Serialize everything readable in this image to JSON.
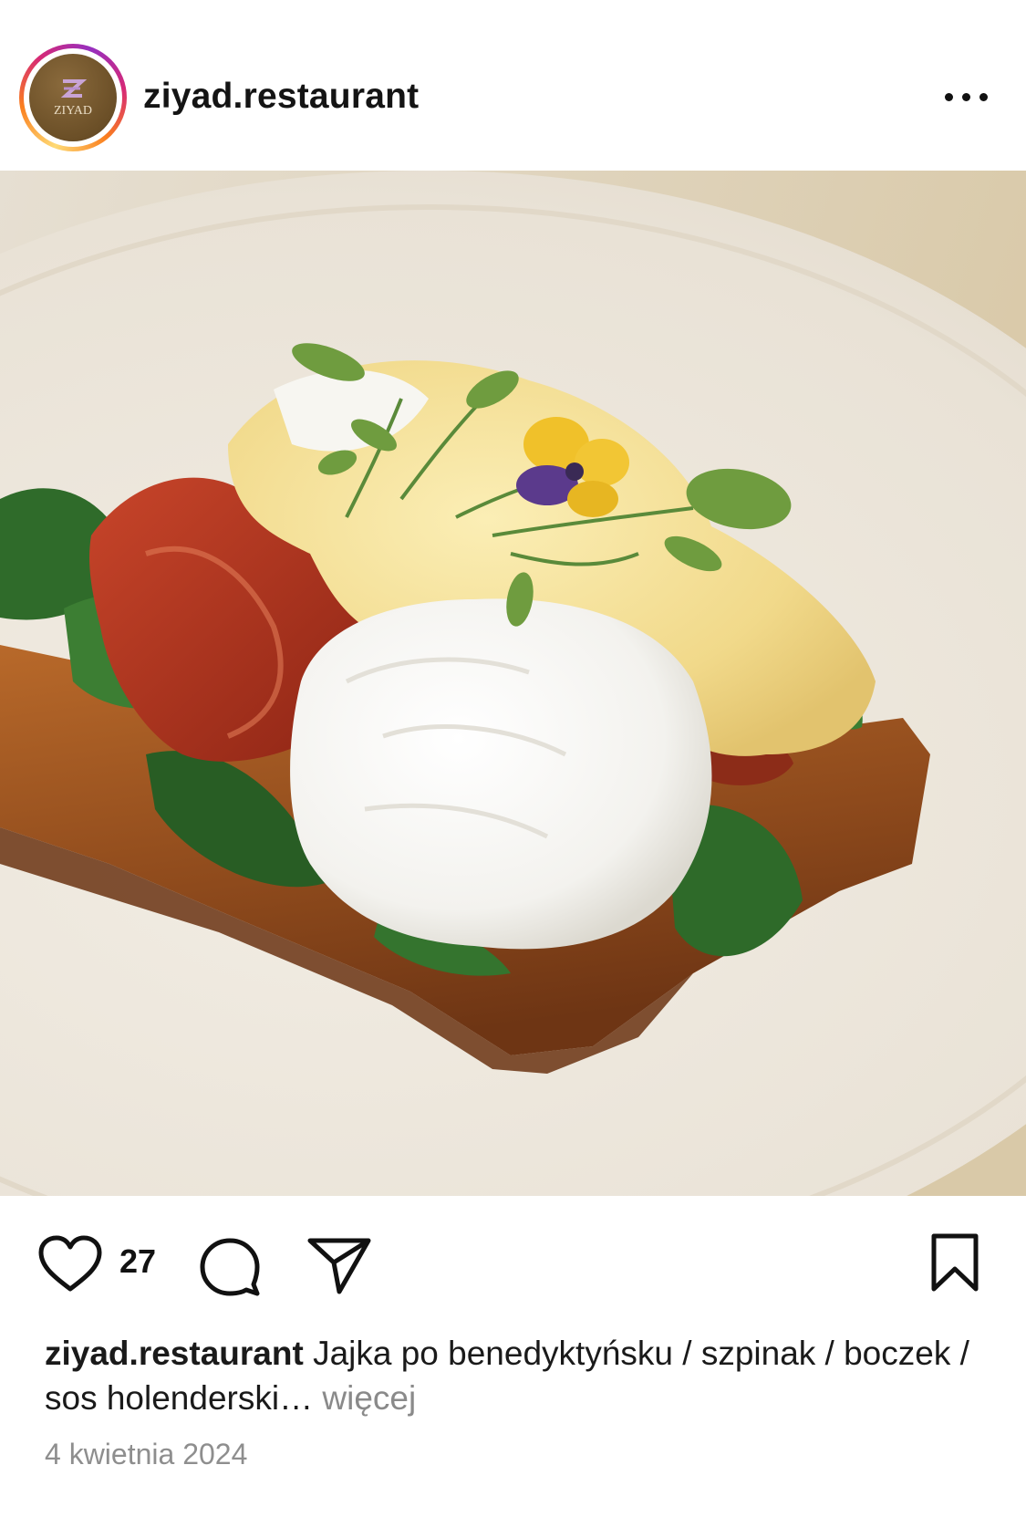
{
  "post": {
    "username": "ziyad.restaurant",
    "avatar_brand": "ZIYAD",
    "like_count": "27",
    "caption_user": "ziyad.restaurant",
    "caption_text": "Jajka po benedyktyńsku / szpinak / boczek / sos holenderski…",
    "more_label": "więcej",
    "date": "4 kwietnia 2024"
  },
  "icons": {
    "more": "more-options-icon",
    "like": "heart-icon",
    "comment": "comment-icon",
    "share": "send-icon",
    "save": "bookmark-icon"
  },
  "colors": {
    "avatar_brown": "#6b4f27",
    "ring_start": "#feda75",
    "ring_mid": "#d62976",
    "ring_end": "#962fbf",
    "muted_text": "#8e8e8e"
  }
}
